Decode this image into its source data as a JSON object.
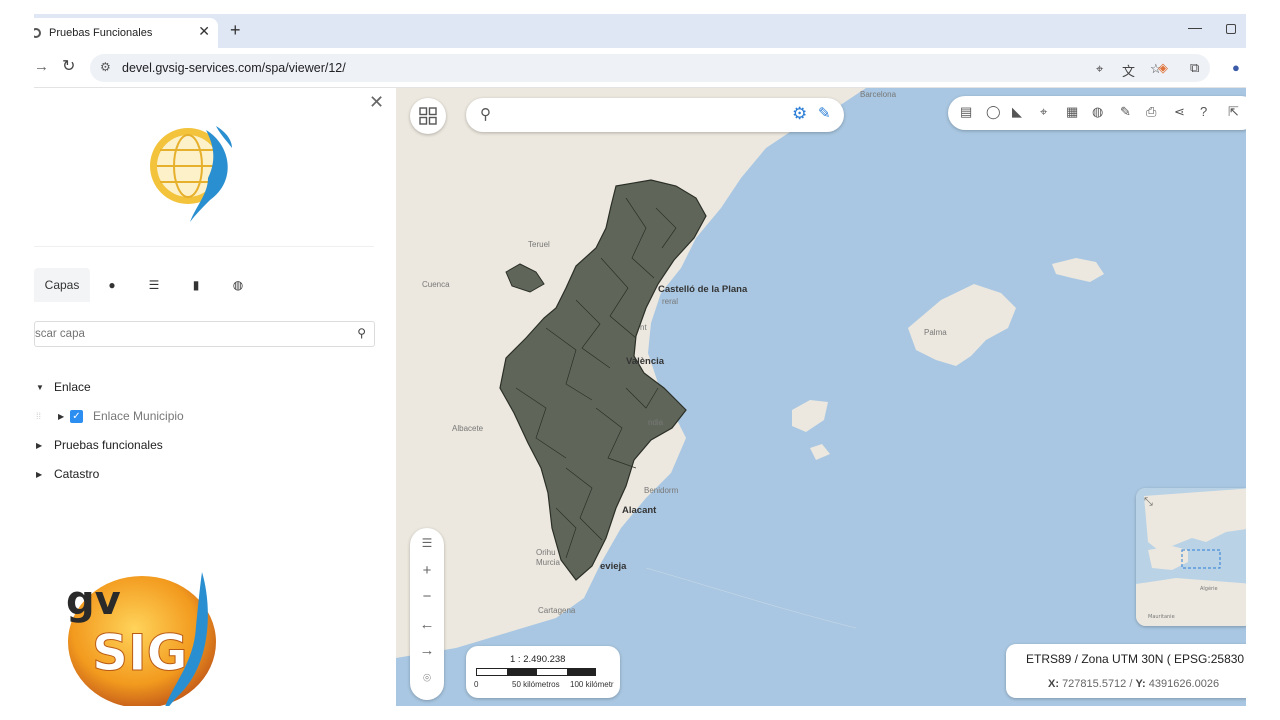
{
  "browser": {
    "tab_title": "Pruebas Funcionales",
    "tab_close": "✕",
    "new_tab": "+",
    "url": "devel.gvsig-services.com/spa/viewer/12/"
  },
  "panel": {
    "close": "✕",
    "tabs": [
      {
        "label": "Capas",
        "icon": "layers-icon"
      },
      {
        "label": "",
        "icon": "tag-icon"
      },
      {
        "label": "",
        "icon": "list-icon"
      },
      {
        "label": "",
        "icon": "bookmark-icon"
      },
      {
        "label": "",
        "icon": "globe-icon"
      }
    ],
    "search_placeholder": "scar capa",
    "tree": {
      "group1": "Enlace",
      "group1_item": "Enlace Municipio",
      "group2": "Pruebas funcionales",
      "group3": "Catastro"
    },
    "logo_text": {
      "gv": "gv",
      "sig": "SIG"
    }
  },
  "map": {
    "labels": {
      "barcelona": "Barcelona",
      "teruel": "Teruel",
      "cuenca": "Cuenca",
      "castello": "Castelló de la Plana",
      "castello_sub": "reral",
      "sagunt": "nt",
      "valencia": "València",
      "gandia": "ndia",
      "benidorm": "Benidorm",
      "alacant": "Alacant",
      "albacete": "Albacete",
      "orihuela": "Orihu",
      "murcia": "Murcia",
      "torrevieja": "evieja",
      "cartagena": "Cartagena",
      "palma": "Palma"
    },
    "scale": {
      "ratio": "1 : 2.490.238",
      "zero": "0",
      "fifty": "50 kilómetros",
      "hundred": "100 kilómetr"
    },
    "crs": "ETRS89 / Zona UTM 30N ( EPSG:25830",
    "coords": {
      "x_label": "X:",
      "x_value": "727815.5712",
      "sep": "/",
      "y_label": "Y:",
      "y_value": "4391626.0026"
    },
    "overview_labels": {
      "algerie": "Algérie",
      "mauritania": "Mauritanie"
    },
    "colors": {
      "sea": "#a9c7e2",
      "land": "#ece8df",
      "layer_fill": "#5f6659",
      "accent": "#2c7ed6"
    }
  }
}
